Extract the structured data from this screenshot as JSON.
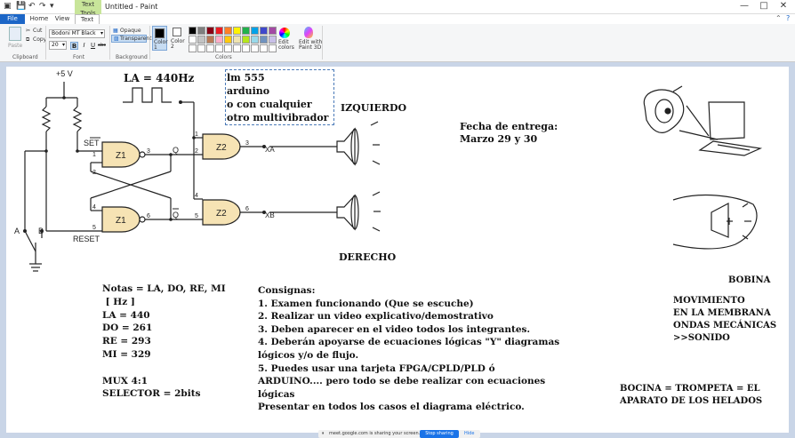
{
  "app": {
    "title": "Untitled - Paint",
    "context_tab": "Text Tools",
    "window_buttons": [
      "—",
      "□",
      "✕"
    ]
  },
  "tabs": [
    {
      "label": "File"
    },
    {
      "label": "Home"
    },
    {
      "label": "View"
    },
    {
      "label": "Text"
    }
  ],
  "ribbon": {
    "clipboard": {
      "label": "Clipboard",
      "paste": "Paste",
      "cut": "Cut",
      "copy": "Copy"
    },
    "font": {
      "label": "Font",
      "name": "Bodoni MT Black",
      "size": "20",
      "bold": "B",
      "italic": "I",
      "underline": "U",
      "strike": "abc"
    },
    "background": {
      "label": "Background",
      "opaque": "Opaque",
      "transparent": "Transparent"
    },
    "colors": {
      "label": "Colors",
      "color1": "Color\n1",
      "color2": "Color\n2",
      "edit": "Edit\ncolors",
      "edit3d": "Edit with\nPaint 3D",
      "palette_row1": [
        "#000000",
        "#7f7f7f",
        "#880015",
        "#ed1c24",
        "#ff7f27",
        "#fff200",
        "#22b14c",
        "#00a2e8",
        "#3f48cc",
        "#a349a4"
      ],
      "palette_row2": [
        "#ffffff",
        "#c3c3c3",
        "#b97a57",
        "#ffaec9",
        "#ffc90e",
        "#efe4b0",
        "#b5e61d",
        "#99d9ea",
        "#7092be",
        "#c8bfe7"
      ]
    }
  },
  "canvas": {
    "la": "LA = 440Hz",
    "textbox": "lm 555\narduino\no con cualquier\notro multivibrador",
    "izquierdo": "IZQUIERDO",
    "derecho": "DERECHO",
    "fecha": "Fecha de entrega:\nMarzo 29 y 30",
    "bobina": "BOBINA",
    "movimiento": "MOVIMIENTO\nEN LA MEMBRANA\nONDAS MECÁNICAS\n>>SONIDO",
    "bocina": "BOCINA = TROMPETA = EL\nAPARATO DE LOS HELADOS",
    "notas": "Notas = LA, DO, RE, MI\n [ Hz ]\nLA = 440\nDO = 261\nRE = 293\nMI = 329\n\nMUX 4:1\nSELECTOR = 2bits",
    "consignas": "Consignas:\n1. Examen funcionando (Que se escuche)\n2. Realizar un video explicativo/demostrativo\n3. Deben aparecer en el video todos los integrantes.\n4. Deberán apoyarse de ecuaciones lógicas \"Y\" diagramas\nlógicos y/o de flujo.\n5. Puedes usar una tarjeta FPGA/CPLD/PLD ó\nARDUINO.... pero todo se debe realizar con ecuaciones\nlógicas\nPresentar en todos los casos el diagrama eléctrico."
  },
  "circuit": {
    "vcc": "+5 V",
    "set": "SET",
    "reset": "RESET",
    "z1": "Z1",
    "z2": "Z2",
    "q": "Q",
    "qbar": "Q",
    "a": "A",
    "b": "B",
    "xa": "XA",
    "xb": "XB",
    "pins": [
      "1",
      "2",
      "3",
      "4",
      "5",
      "6",
      "1",
      "2",
      "3",
      "4",
      "5",
      "6"
    ]
  },
  "sharebar": {
    "text": "meet.google.com is sharing your screen.",
    "stop": "Stop sharing",
    "hide": "Hide"
  }
}
